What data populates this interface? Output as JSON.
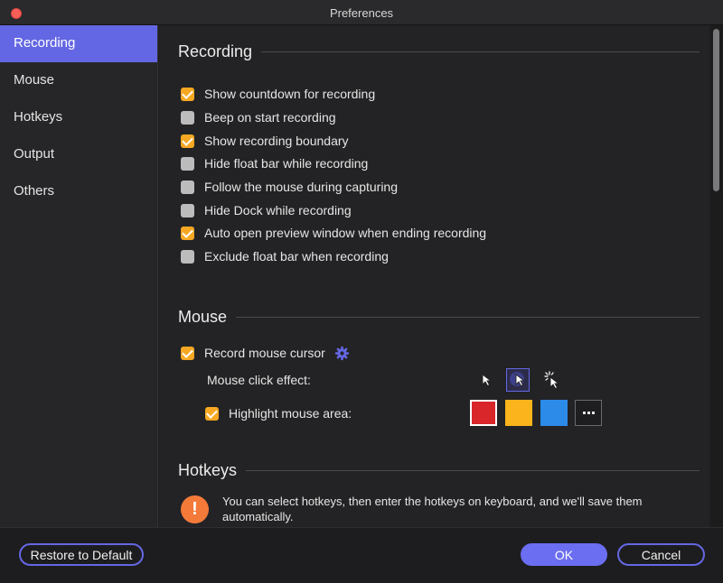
{
  "window": {
    "title": "Preferences"
  },
  "sidebar": {
    "items": [
      {
        "label": "Recording",
        "active": true
      },
      {
        "label": "Mouse",
        "active": false
      },
      {
        "label": "Hotkeys",
        "active": false
      },
      {
        "label": "Output",
        "active": false
      },
      {
        "label": "Others",
        "active": false
      }
    ]
  },
  "recording": {
    "title": "Recording",
    "options": [
      {
        "label": "Show countdown for recording",
        "checked": true
      },
      {
        "label": "Beep on start recording",
        "checked": false
      },
      {
        "label": "Show recording boundary",
        "checked": true
      },
      {
        "label": "Hide float bar while recording",
        "checked": false
      },
      {
        "label": "Follow the mouse during capturing",
        "checked": false
      },
      {
        "label": "Hide Dock while recording",
        "checked": false
      },
      {
        "label": "Auto open preview window when ending recording",
        "checked": true
      },
      {
        "label": "Exclude float bar when recording",
        "checked": false
      }
    ]
  },
  "mouse": {
    "title": "Mouse",
    "record_cursor": {
      "label": "Record mouse cursor",
      "checked": true
    },
    "click_effect_label": "Mouse click effect:",
    "click_effects": [
      {
        "icon": "cursor-plain-icon",
        "selected": false
      },
      {
        "icon": "cursor-circle-icon",
        "selected": true
      },
      {
        "icon": "cursor-rays-icon",
        "selected": false
      }
    ],
    "highlight": {
      "label": "Highlight mouse area:",
      "checked": true
    },
    "highlight_colors": [
      "#d9262a",
      "#fbb41b",
      "#2c8ae8"
    ],
    "settings_icon": "gear-icon",
    "more_colors_icon": "more-dots-icon"
  },
  "hotkeys": {
    "title": "Hotkeys",
    "info_icon": "!",
    "info_text": "You can select hotkeys, then enter the hotkeys on keyboard, and we'll save them automatically."
  },
  "footer": {
    "restore_label": "Restore to Default",
    "ok_label": "OK",
    "cancel_label": "Cancel"
  },
  "colors": {
    "accent": "#6467e3",
    "checkbox_on": "#f7a823",
    "info": "#f47a3a"
  }
}
